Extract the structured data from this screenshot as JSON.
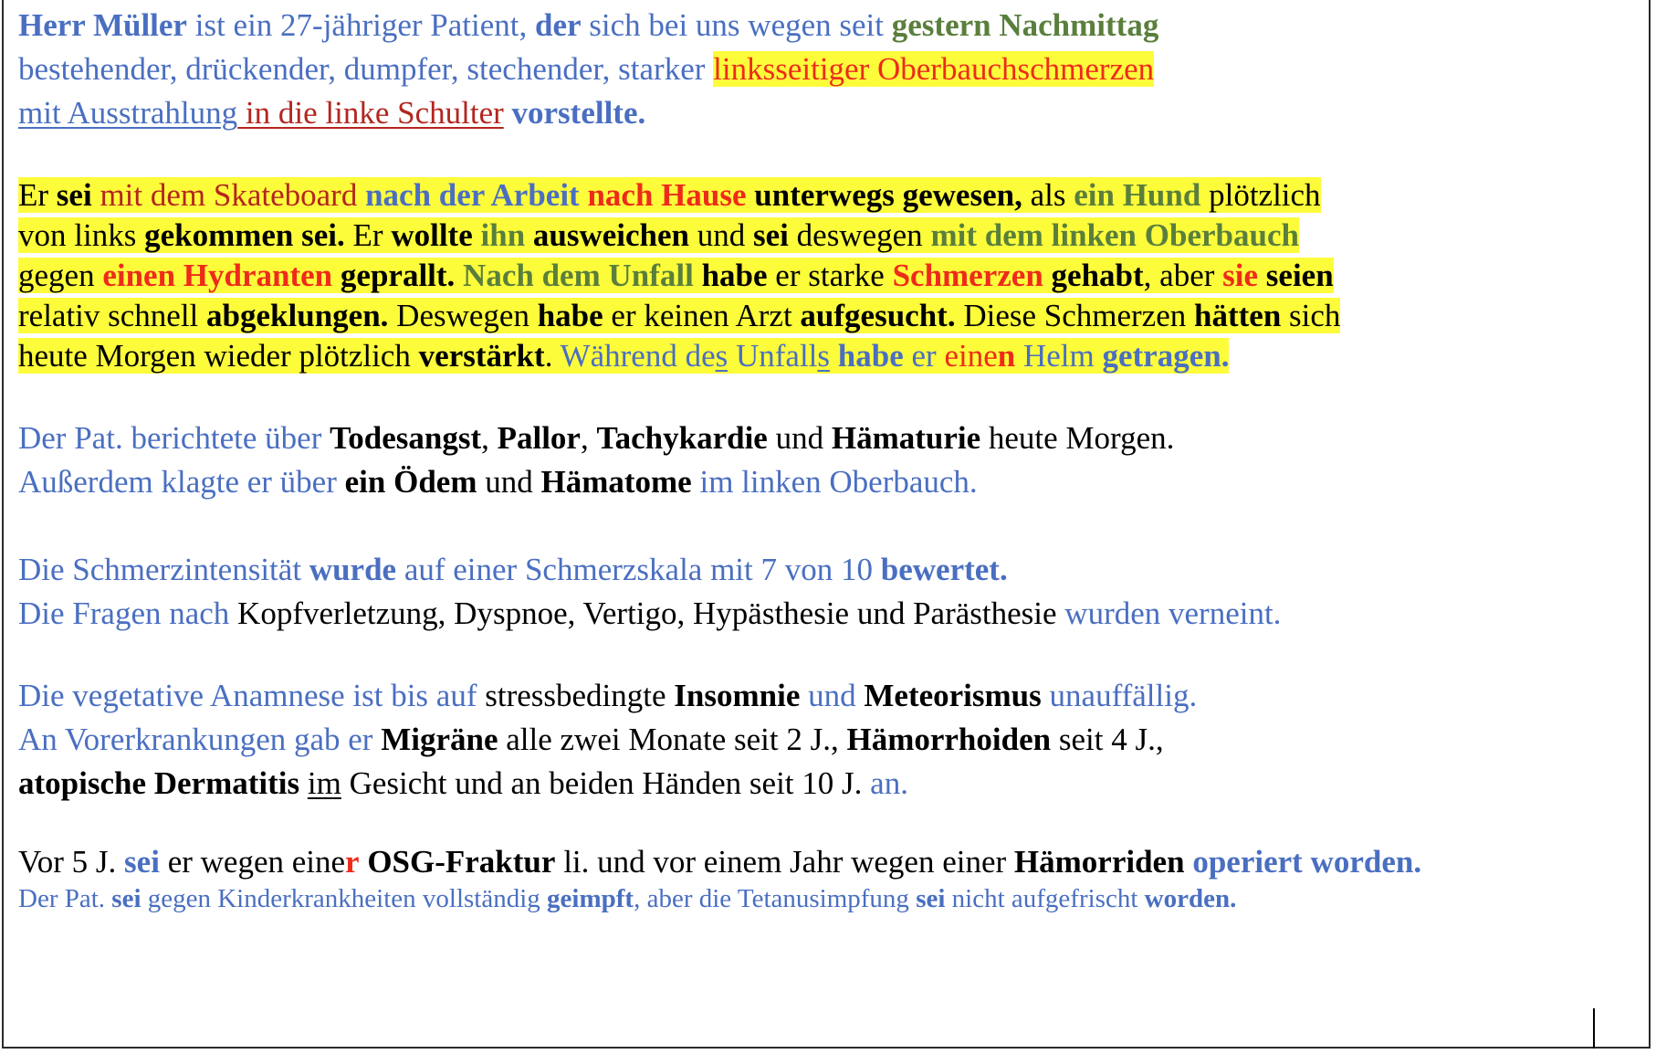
{
  "document": {
    "lines": [
      {
        "segments": [
          {
            "t": "Herr Müller",
            "c": "bl",
            "b": true
          },
          {
            "t": " ist ein 27-jähriger Patient, ",
            "c": "bl"
          },
          {
            "t": "der",
            "c": "bl",
            "b": true
          },
          {
            "t": " sich bei uns wegen seit ",
            "c": "bl"
          },
          {
            "t": "gestern Nachmittag",
            "c": "gr",
            "b": true
          }
        ]
      },
      {
        "segments": [
          {
            "t": "bestehender, drückender, dumpfer, stechender, starker ",
            "c": "bl"
          },
          {
            "t": "linksseitiger Oberbauchschmerzen",
            "c": "rd",
            "hl": true
          }
        ]
      },
      {
        "segments": [
          {
            "t": "mit Ausstrahlung",
            "c": "bl",
            "u": true
          },
          {
            "t": " in die linke Schulter",
            "c": "dr",
            "u": true
          },
          {
            "t": " ",
            "c": "bl"
          },
          {
            "t": "vorstellte.",
            "c": "bl",
            "b": true
          }
        ]
      },
      {
        "segments": [
          {
            "t": "Er ",
            "c": "k",
            "hl": true
          },
          {
            "t": "sei",
            "c": "k",
            "b": true,
            "hl": true
          },
          {
            "t": " mit dem Skateboard ",
            "c": "dr",
            "hl": true
          },
          {
            "t": "nach der Arbeit",
            "c": "bl",
            "b": true,
            "hl": true
          },
          {
            "t": " ",
            "c": "k",
            "hl": true
          },
          {
            "t": "nach Hause",
            "c": "rd",
            "b": true,
            "hl": true
          },
          {
            "t": " ",
            "c": "k",
            "hl": true
          },
          {
            "t": "unterwegs gewesen,",
            "c": "k",
            "b": true,
            "hl": true
          },
          {
            "t": " als ",
            "c": "k",
            "hl": true
          },
          {
            "t": "ein Hund",
            "c": "gr",
            "b": true,
            "hl": true
          },
          {
            "t": " plötzlich",
            "c": "k",
            "hl": true
          }
        ]
      },
      {
        "segments": [
          {
            "t": "von links ",
            "c": "k",
            "hl": true
          },
          {
            "t": "gekommen sei.",
            "c": "k",
            "b": true,
            "hl": true
          },
          {
            "t": " Er ",
            "c": "k",
            "hl": true
          },
          {
            "t": "wollte",
            "c": "k",
            "b": true,
            "hl": true
          },
          {
            "t": " ",
            "c": "k",
            "hl": true
          },
          {
            "t": "ihn",
            "c": "gr",
            "b": true,
            "hl": true
          },
          {
            "t": " ",
            "c": "k",
            "hl": true
          },
          {
            "t": "ausweichen",
            "c": "k",
            "b": true,
            "hl": true
          },
          {
            "t": " und ",
            "c": "k",
            "hl": true
          },
          {
            "t": "sei",
            "c": "k",
            "b": true,
            "hl": true
          },
          {
            "t": " deswegen ",
            "c": "k",
            "hl": true
          },
          {
            "t": "mit dem linken Oberbauch",
            "c": "gr",
            "b": true,
            "hl": true
          }
        ]
      },
      {
        "segments": [
          {
            "t": "gegen ",
            "c": "k",
            "hl": true
          },
          {
            "t": "einen Hydranten",
            "c": "rd",
            "b": true,
            "hl": true
          },
          {
            "t": " ",
            "c": "k",
            "hl": true
          },
          {
            "t": "geprallt.",
            "c": "k",
            "b": true,
            "hl": true
          },
          {
            "t": " ",
            "c": "k",
            "hl": true
          },
          {
            "t": "Nach dem Unfall",
            "c": "gr",
            "b": true,
            "hl": true
          },
          {
            "t": " ",
            "c": "k",
            "hl": true
          },
          {
            "t": "habe",
            "c": "k",
            "b": true,
            "hl": true
          },
          {
            "t": " er starke ",
            "c": "k",
            "hl": true
          },
          {
            "t": "Schmerzen",
            "c": "rd",
            "b": true,
            "hl": true
          },
          {
            "t": " ",
            "c": "k",
            "hl": true
          },
          {
            "t": "gehabt",
            "c": "k",
            "b": true,
            "hl": true
          },
          {
            "t": ", aber ",
            "c": "k",
            "hl": true
          },
          {
            "t": "sie",
            "c": "rd",
            "b": true,
            "hl": true
          },
          {
            "t": " ",
            "c": "k",
            "hl": true
          },
          {
            "t": "seien",
            "c": "k",
            "b": true,
            "hl": true
          }
        ]
      },
      {
        "segments": [
          {
            "t": "relativ schnell ",
            "c": "k",
            "hl": true
          },
          {
            "t": "abgeklungen.",
            "c": "k",
            "b": true,
            "hl": true
          },
          {
            "t": " Deswegen ",
            "c": "k",
            "hl": true
          },
          {
            "t": "habe",
            "c": "k",
            "b": true,
            "hl": true
          },
          {
            "t": " er keinen Arzt ",
            "c": "k",
            "hl": true
          },
          {
            "t": "aufgesucht.",
            "c": "k",
            "b": true,
            "hl": true
          },
          {
            "t": " Diese Schmerzen ",
            "c": "k",
            "hl": true
          },
          {
            "t": "hätten",
            "c": "k",
            "b": true,
            "hl": true
          },
          {
            "t": " sich",
            "c": "k",
            "hl": true
          }
        ]
      },
      {
        "segments": [
          {
            "t": "heute Morgen wieder plötzlich ",
            "c": "k",
            "hl": true
          },
          {
            "t": "verstärkt",
            "c": "k",
            "b": true,
            "hl": true
          },
          {
            "t": ". ",
            "c": "k",
            "hl": true
          },
          {
            "t": "Während de",
            "c": "bl",
            "hl": true
          },
          {
            "t": "s",
            "c": "bl",
            "u": true,
            "hl": true
          },
          {
            "t": " Unfall",
            "c": "bl",
            "hl": true
          },
          {
            "t": "s",
            "c": "bl",
            "u": true,
            "hl": true
          },
          {
            "t": " ",
            "c": "bl",
            "hl": true
          },
          {
            "t": "habe",
            "c": "bl",
            "b": true,
            "hl": true
          },
          {
            "t": " er ",
            "c": "bl",
            "hl": true
          },
          {
            "t": "eine",
            "c": "rd",
            "hl": true
          },
          {
            "t": "n",
            "c": "rd",
            "b": true,
            "hl": true
          },
          {
            "t": " Helm ",
            "c": "bl",
            "hl": true
          },
          {
            "t": "getragen.",
            "c": "bl",
            "b": true,
            "hl": true
          }
        ]
      },
      {
        "segments": [
          {
            "t": "Der Pat. berichtete über ",
            "c": "bl"
          },
          {
            "t": "Todesangst",
            "c": "k",
            "b": true
          },
          {
            "t": ", ",
            "c": "k"
          },
          {
            "t": "Pallor",
            "c": "k",
            "b": true
          },
          {
            "t": ", ",
            "c": "k"
          },
          {
            "t": "Tachykardie",
            "c": "k",
            "b": true
          },
          {
            "t": " und ",
            "c": "k"
          },
          {
            "t": "Hämaturie",
            "c": "k",
            "b": true
          },
          {
            "t": " heute Morgen.",
            "c": "k"
          }
        ]
      },
      {
        "segments": [
          {
            "t": "Außerdem klagte er über ",
            "c": "bl"
          },
          {
            "t": "ein Ödem",
            "c": "k",
            "b": true
          },
          {
            "t": " und ",
            "c": "k"
          },
          {
            "t": "Hämatome",
            "c": "k",
            "b": true
          },
          {
            "t": " im linken Oberbauch.",
            "c": "bl"
          }
        ]
      },
      {
        "segments": [
          {
            "t": "Die Schmerzintensität ",
            "c": "bl"
          },
          {
            "t": "wurde",
            "c": "bl",
            "b": true
          },
          {
            "t": " auf einer Schmerzskala mit 7 von 10 ",
            "c": "bl"
          },
          {
            "t": "bewertet.",
            "c": "bl",
            "b": true
          }
        ]
      },
      {
        "segments": [
          {
            "t": "Die Fragen nach ",
            "c": "bl"
          },
          {
            "t": "Kopfverletzung, Dyspnoe, Vertigo, Hypästhesie und Parästhesie ",
            "c": "k"
          },
          {
            "t": "wurden verneint.",
            "c": "bl"
          }
        ]
      },
      {
        "segments": [
          {
            "t": "Die vegetative Anamnese ist bis auf ",
            "c": "bl"
          },
          {
            "t": "stressbedingte ",
            "c": "k"
          },
          {
            "t": "Insomnie",
            "c": "k",
            "b": true
          },
          {
            "t": " und ",
            "c": "bl"
          },
          {
            "t": "Meteorismus",
            "c": "k",
            "b": true
          },
          {
            "t": " unauffällig.",
            "c": "bl"
          }
        ]
      },
      {
        "segments": [
          {
            "t": "An Vorerkrankungen gab er ",
            "c": "bl"
          },
          {
            "t": "Migräne",
            "c": "k",
            "b": true
          },
          {
            "t": " alle zwei Monate seit 2 J., ",
            "c": "k"
          },
          {
            "t": "Hämorrhoiden",
            "c": "k",
            "b": true
          },
          {
            "t": " seit 4 J.,",
            "c": "k"
          }
        ]
      },
      {
        "segments": [
          {
            "t": "atopische Dermatitis",
            "c": "k",
            "b": true
          },
          {
            "t": " ",
            "c": "k"
          },
          {
            "t": "im",
            "c": "k",
            "u": true
          },
          {
            "t": " Gesicht und an beiden Händen seit 10 J. ",
            "c": "k"
          },
          {
            "t": "an.",
            "c": "bl"
          }
        ]
      },
      {
        "segments": [
          {
            "t": "Vor 5 J. ",
            "c": "k"
          },
          {
            "t": "sei",
            "c": "bl",
            "b": true
          },
          {
            "t": " er wegen eine",
            "c": "k"
          },
          {
            "t": "r",
            "c": "rd",
            "b": true
          },
          {
            "t": " ",
            "c": "k"
          },
          {
            "t": "OSG-Fraktur",
            "c": "k",
            "b": true
          },
          {
            "t": " li. und vor einem Jahr wegen einer ",
            "c": "k"
          },
          {
            "t": "Hämorriden",
            "c": "k",
            "b": true
          },
          {
            "t": " ",
            "c": "k"
          },
          {
            "t": "operiert worden.",
            "c": "bl",
            "b": true
          }
        ]
      },
      {
        "small": true,
        "segments": [
          {
            "t": "Der Pat. ",
            "c": "bl"
          },
          {
            "t": "sei",
            "c": "bl",
            "b": true
          },
          {
            "t": " gegen Kinderkrankheiten vollständig ",
            "c": "bl"
          },
          {
            "t": "geimpft",
            "c": "bl",
            "b": true
          },
          {
            "t": ", aber die Tetanusimpfung ",
            "c": "bl"
          },
          {
            "t": "sei",
            "c": "bl",
            "b": true
          },
          {
            "t": " nicht aufgefrischt ",
            "c": "bl"
          },
          {
            "t": "worden.",
            "c": "bl",
            "b": true
          }
        ]
      }
    ]
  }
}
